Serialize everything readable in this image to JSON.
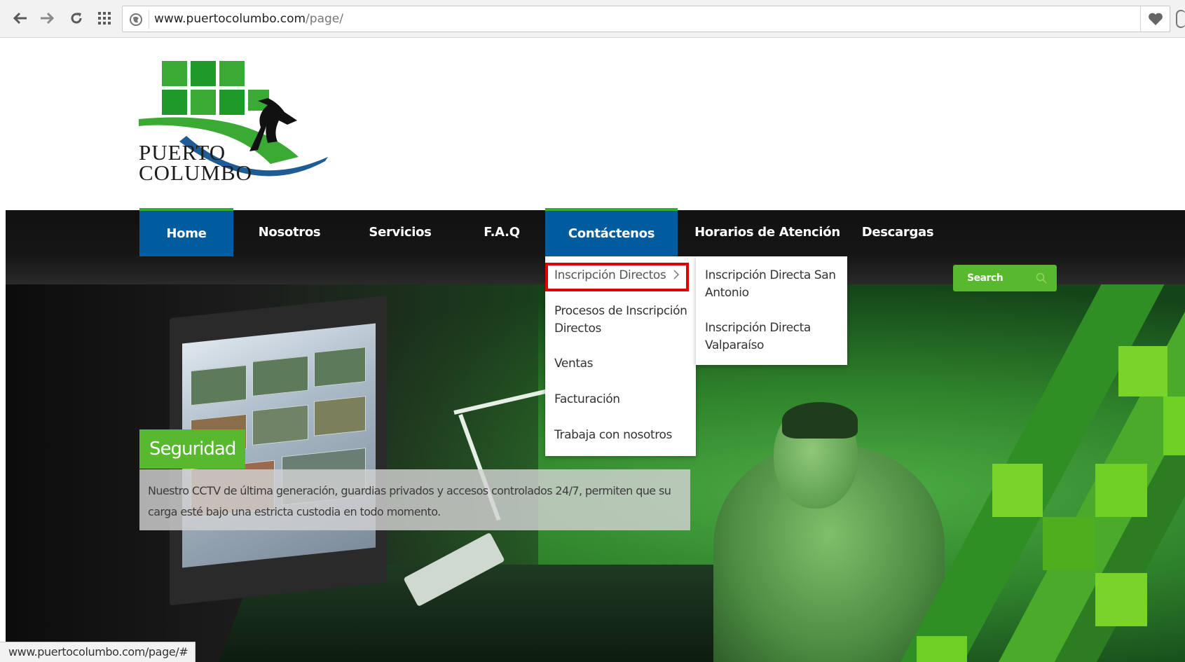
{
  "browser": {
    "url_domain": "www.puertocolumbo.com",
    "url_path": "/page/",
    "status_url": "www.puertocolumbo.com/page/#",
    "icons": [
      "back-arrow-icon",
      "forward-arrow-icon",
      "reload-icon",
      "apps-grid-icon",
      "site-info-icon",
      "heart-icon"
    ]
  },
  "logo": {
    "line1": "PUERTO",
    "line2": "COLUMBO",
    "colors": {
      "green": "#3aaa35",
      "dark_green": "#1f8a1f",
      "blue_wave": "#1f5c96"
    }
  },
  "nav": {
    "items": [
      {
        "label": "Home",
        "active": true
      },
      {
        "label": "Nosotros",
        "active": false
      },
      {
        "label": "Servicios",
        "active": false
      },
      {
        "label": "F.A.Q",
        "active": false
      },
      {
        "label": "Contáctenos",
        "active": true
      },
      {
        "label": "Horarios de Atención",
        "active": false
      },
      {
        "label": "Descargas",
        "active": false
      }
    ],
    "active_color": "#005c9e"
  },
  "dropdown": {
    "items": [
      "Inscripción Directos",
      "Procesos de Inscripción Directos",
      "Ventas",
      "Facturación",
      "Trabaja con nosotros"
    ],
    "submenu": [
      "Inscripción Directa San Antonio",
      "Inscripción Directa Valparaíso"
    ],
    "highlight_color": "#e00000"
  },
  "search": {
    "label": "Search"
  },
  "hero": {
    "title": "Seguridad",
    "text": "Nuestro CCTV de última generación, guardias privados y accesos controlados 24/7, permiten que su carga esté bajo una estricta custodia en todo momento.",
    "accent_color": "#58b92e"
  }
}
